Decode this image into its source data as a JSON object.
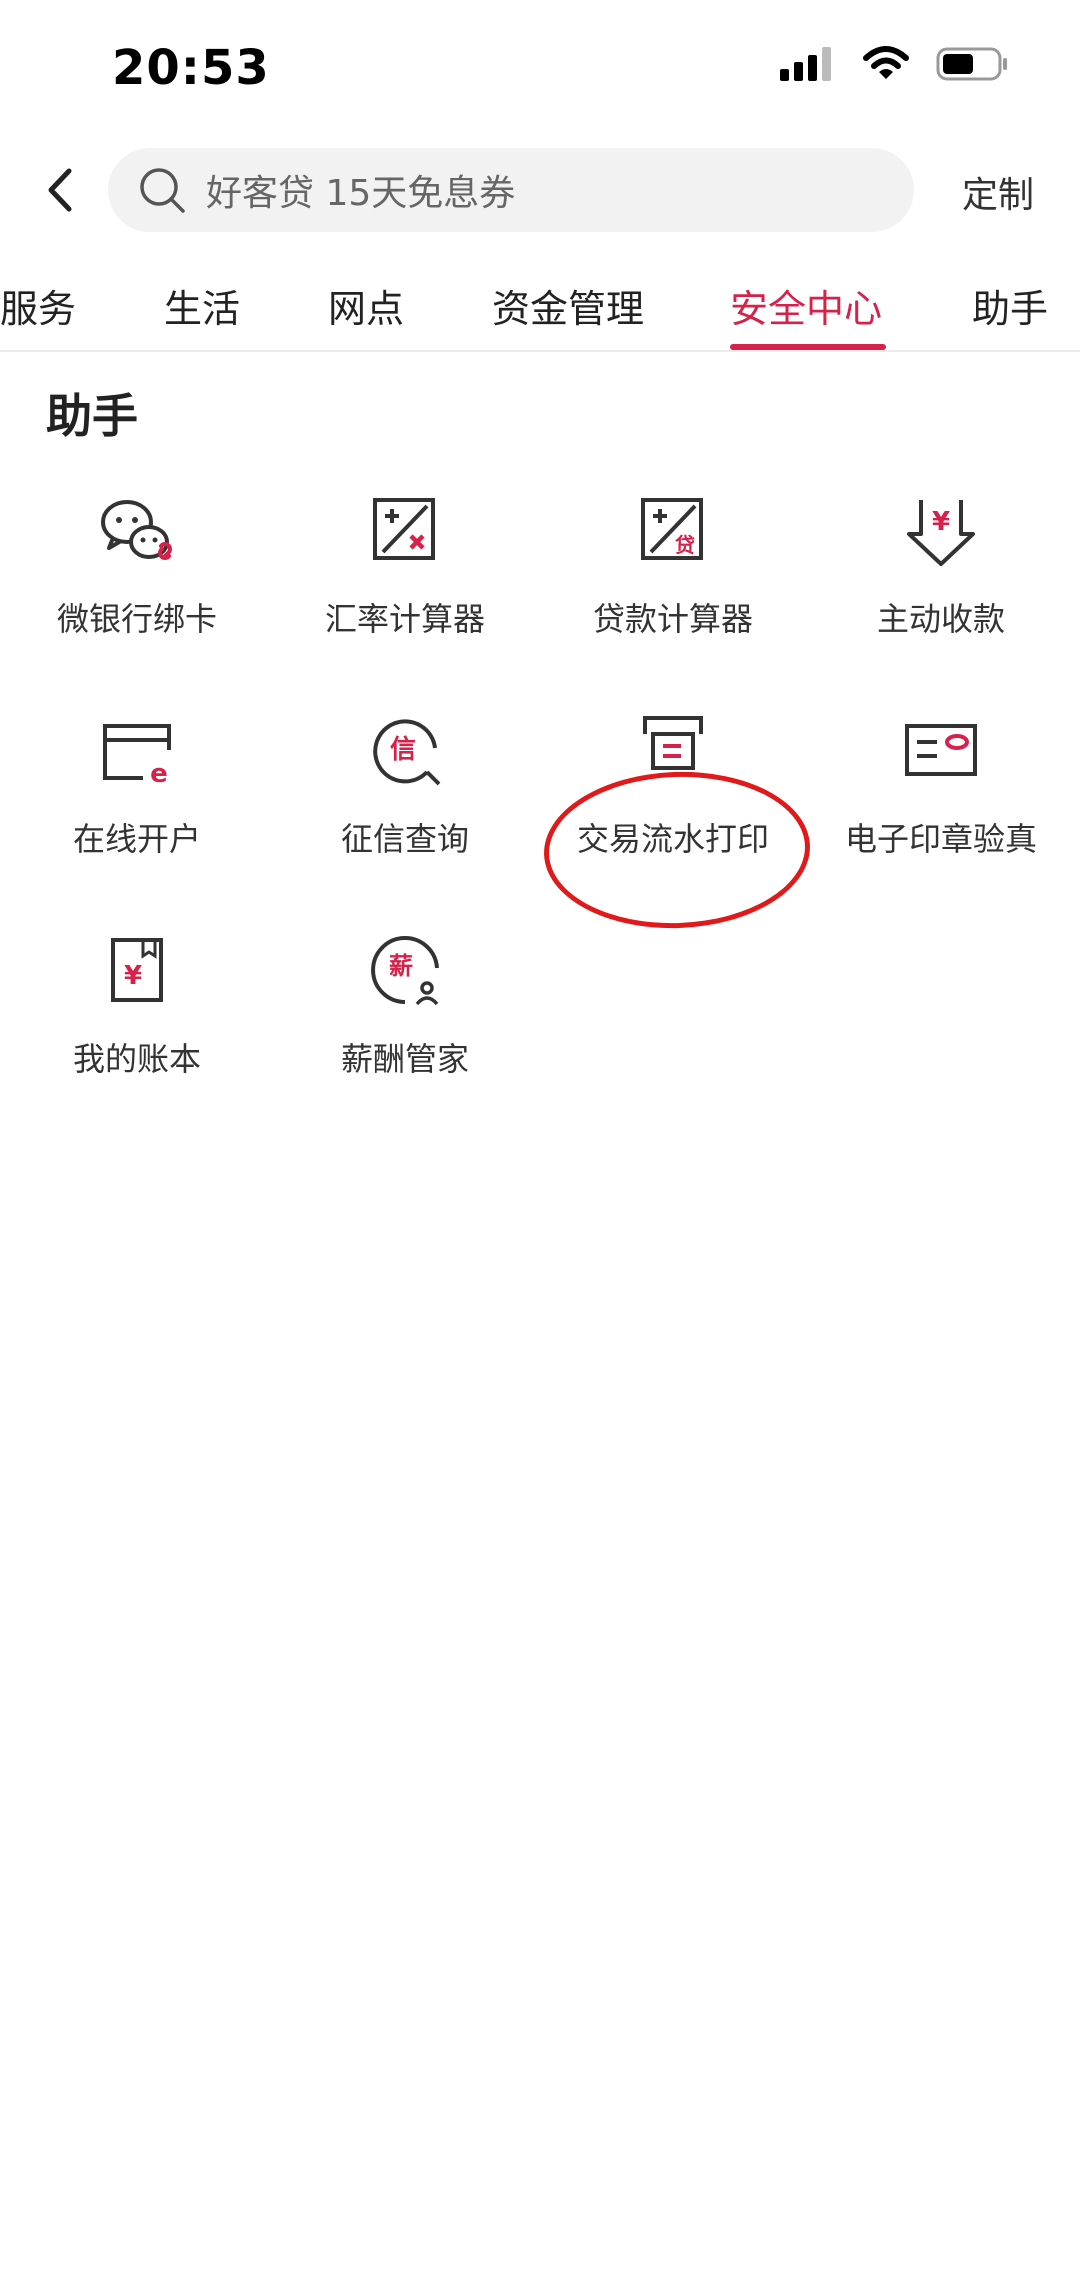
{
  "status": {
    "time": "20:53"
  },
  "search": {
    "placeholder": "好客贷 15天免息券",
    "customize_label": "定制"
  },
  "tabs": [
    {
      "label": "服务",
      "active": false
    },
    {
      "label": "生活",
      "active": false
    },
    {
      "label": "网点",
      "active": false
    },
    {
      "label": "资金管理",
      "active": false
    },
    {
      "label": "安全中心",
      "active": true
    },
    {
      "label": "助手",
      "active": false
    }
  ],
  "section": {
    "title": "助手"
  },
  "items": [
    {
      "label": "微银行绑卡",
      "icon": "wechat-bind-icon"
    },
    {
      "label": "汇率计算器",
      "icon": "exchange-calculator-icon"
    },
    {
      "label": "贷款计算器",
      "icon": "loan-calculator-icon"
    },
    {
      "label": "主动收款",
      "icon": "receive-payment-icon"
    },
    {
      "label": "在线开户",
      "icon": "online-account-icon"
    },
    {
      "label": "征信查询",
      "icon": "credit-inquiry-icon"
    },
    {
      "label": "交易流水打印",
      "icon": "transaction-print-icon"
    },
    {
      "label": "电子印章验真",
      "icon": "e-seal-verify-icon"
    },
    {
      "label": "我的账本",
      "icon": "ledger-icon"
    },
    {
      "label": "薪酬管家",
      "icon": "salary-manager-icon"
    }
  ],
  "icon_glyphs": {
    "credit": "信",
    "salary": "薪",
    "loan": "贷",
    "yuan": "¥",
    "e": "e"
  },
  "colors": {
    "accent": "#d6224b",
    "annotation": "#e01a1a"
  }
}
